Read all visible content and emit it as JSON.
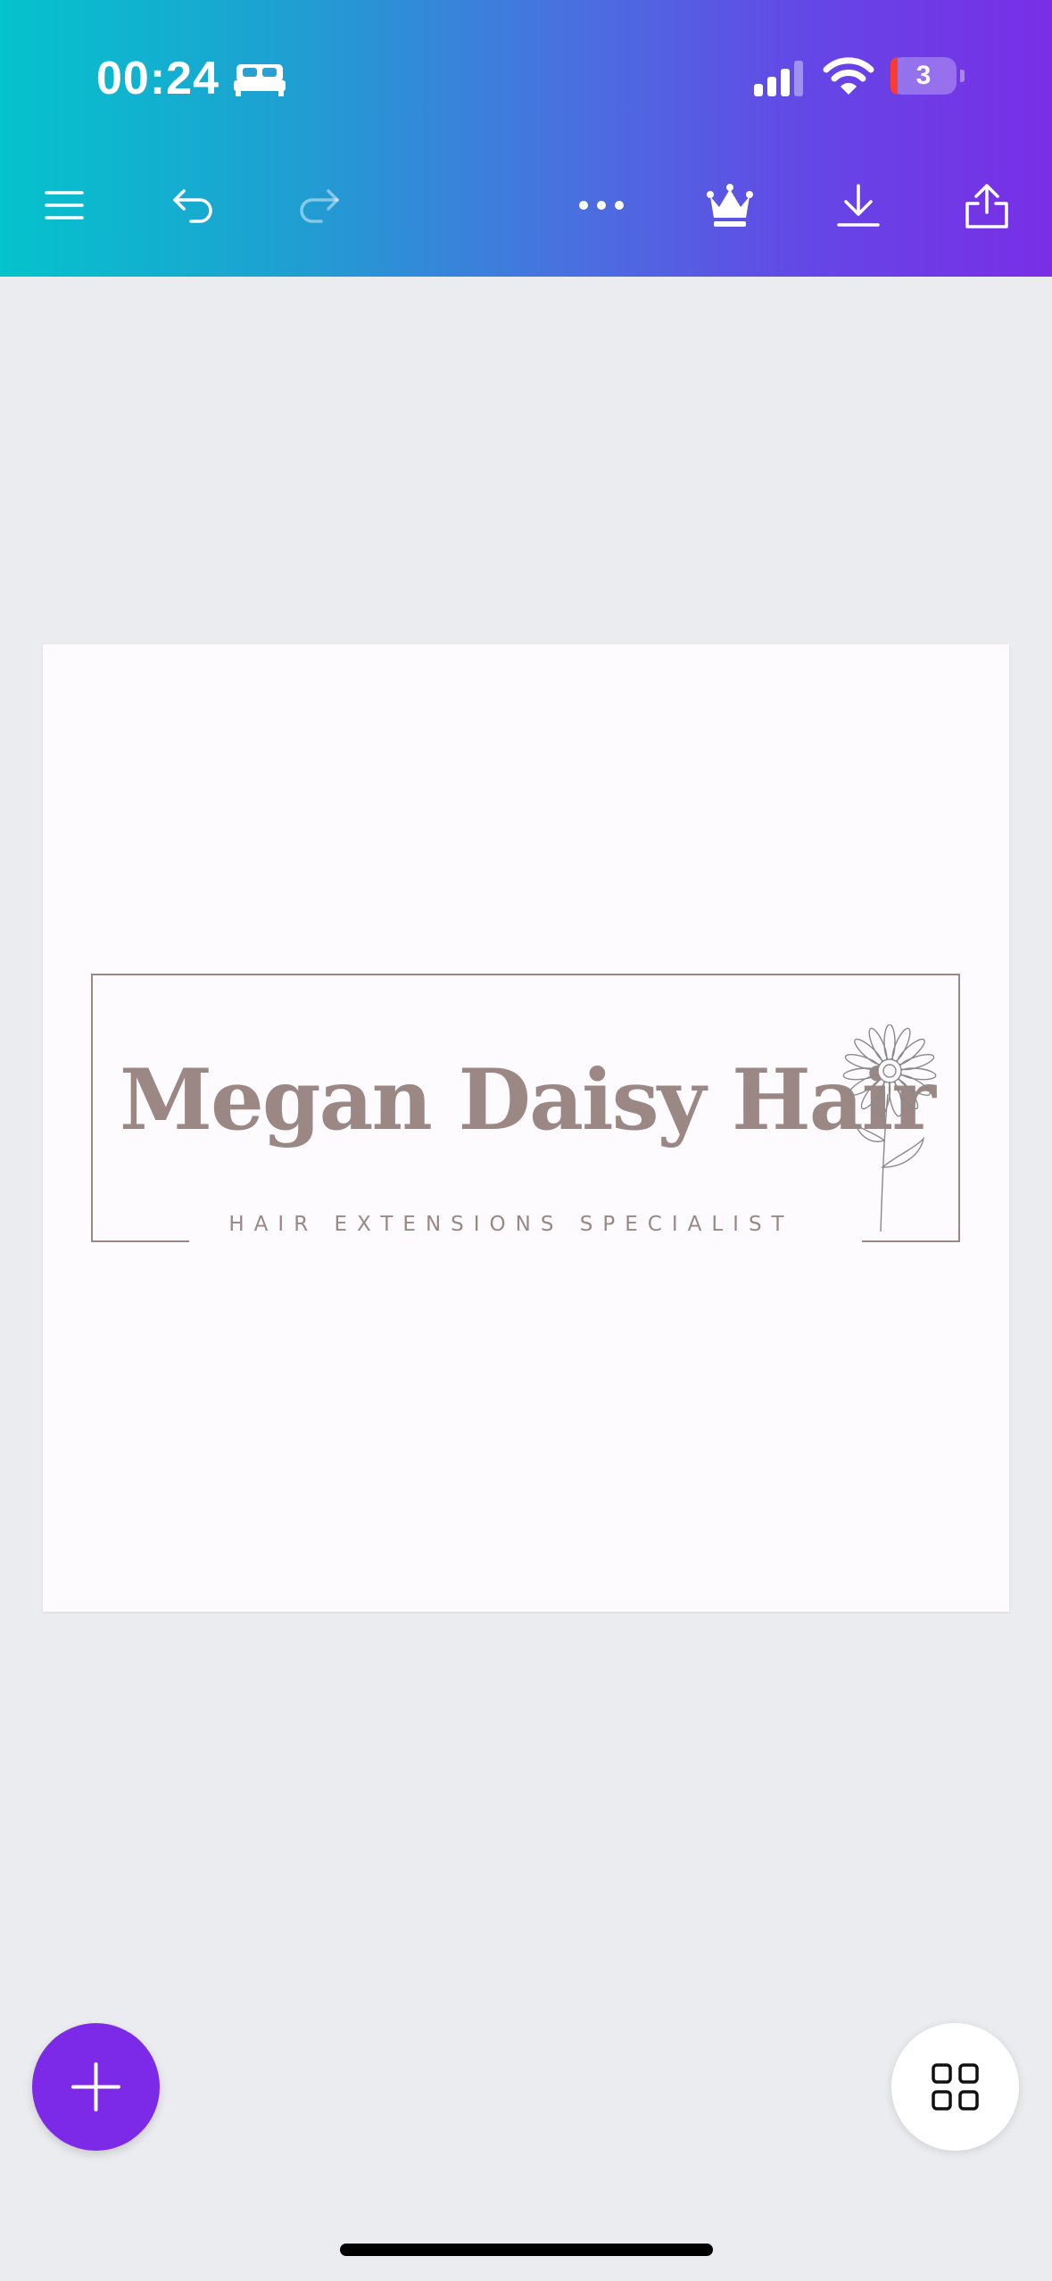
{
  "status_bar": {
    "time": "00:24",
    "battery_level": "3",
    "icons": [
      "bed-icon",
      "signal-icon",
      "wifi-icon",
      "battery-icon"
    ]
  },
  "toolbar": {
    "icons": [
      "menu-icon",
      "undo-icon",
      "redo-icon",
      "more-icon",
      "crown-icon",
      "download-icon",
      "share-icon"
    ],
    "redo_enabled": false,
    "colors": {
      "gradient_start": "#04c3cc",
      "gradient_end": "#7a2ee6"
    }
  },
  "design": {
    "title": "Megan Daisy Hair",
    "tagline": "HAIR EXTENSIONS SPECIALIST",
    "text_color": "#9b8784",
    "illustration": "daisy-icon"
  },
  "fabs": {
    "add_icon": "plus-icon",
    "pages_icon": "grid-icon",
    "accent": "#7d2ae8"
  }
}
